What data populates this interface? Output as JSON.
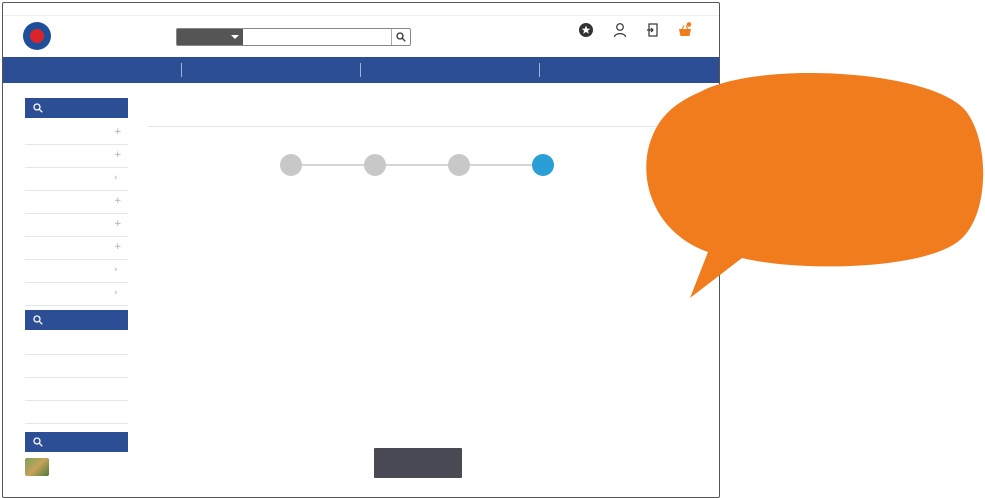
{
  "colors": {
    "nav_blue": "#2b4e94",
    "step_active": "#2a9fd6",
    "step_inactive": "#c8c8c8",
    "button_dark": "#4a4a55",
    "callout_orange": "#f07c1e"
  },
  "icons": [
    "site-logo",
    "search-icon",
    "favorites-icon",
    "mypage-icon",
    "logout-icon",
    "cart-icon",
    "chevron-down-icon",
    "plus-icon",
    "chevron-right-icon"
  ]
}
